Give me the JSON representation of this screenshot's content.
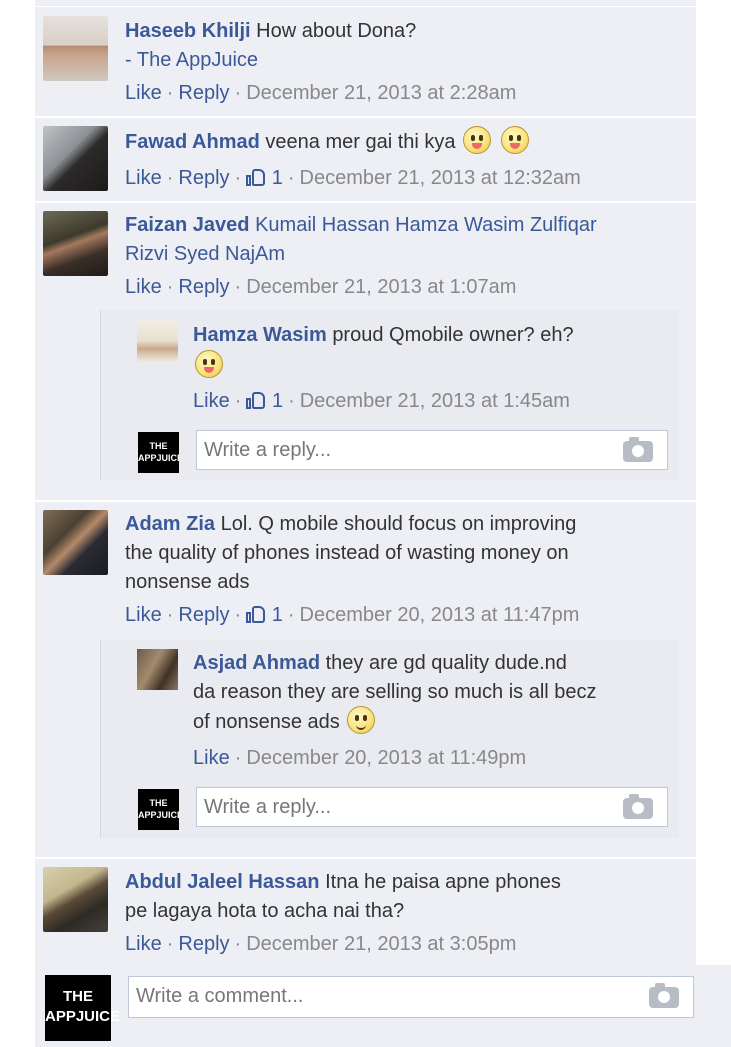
{
  "comments": [
    {
      "author": "Haseeb Khilji",
      "text1": "How about Dona?",
      "text2": "- The AppJuice",
      "actions": {
        "like": "Like",
        "reply": "Reply"
      },
      "timestamp": "December 21, 2013 at 2:28am"
    },
    {
      "author": "Fawad Ahmad",
      "text1": "veena mer gai thi kya",
      "actions": {
        "like": "Like",
        "reply": "Reply"
      },
      "like_count": "1",
      "timestamp": "December 21, 2013 at 12:32am"
    },
    {
      "author": "Faizan Javed",
      "text1": "Kumail Hassan Hamza Wasim Zulfiqar",
      "text2": "Rizvi Syed NajAm",
      "actions": {
        "like": "Like",
        "reply": "Reply"
      },
      "timestamp": "December 21, 2013 at 1:07am",
      "replies": [
        {
          "author": "Hamza Wasim",
          "text1": "proud Qmobile owner? eh?",
          "actions": {
            "like": "Like"
          },
          "like_count": "1",
          "timestamp": "December 21, 2013 at 1:45am"
        }
      ]
    },
    {
      "author": "Adam Zia",
      "text1": "Lol. Q mobile should focus on improving",
      "text2": "the quality of phones instead of wasting money on",
      "text3": "nonsense ads",
      "actions": {
        "like": "Like",
        "reply": "Reply"
      },
      "like_count": "1",
      "timestamp": "December 20, 2013 at 11:47pm",
      "replies": [
        {
          "author": "Asjad Ahmad",
          "text1": "they are gd quality dude.nd",
          "text2": "da reason they are selling so much is all becz",
          "text3": "of nonsense ads",
          "actions": {
            "like": "Like"
          },
          "timestamp": "December 20, 2013 at 11:49pm"
        }
      ]
    },
    {
      "author": "Abdul Jaleel Hassan",
      "text1": "Itna he paisa apne phones",
      "text2": "pe lagaya hota to acha nai tha?",
      "actions": {
        "like": "Like",
        "reply": "Reply"
      },
      "timestamp": "December 21, 2013 at 3:05pm"
    }
  ],
  "reply_placeholder": "Write a reply...",
  "comment_placeholder": "Write a comment...",
  "page_logo": {
    "line1": "THE",
    "line2": "APPJUICE"
  },
  "colors": {
    "link": "#3b5998",
    "background": "#edeff4",
    "meta": "#888888"
  }
}
